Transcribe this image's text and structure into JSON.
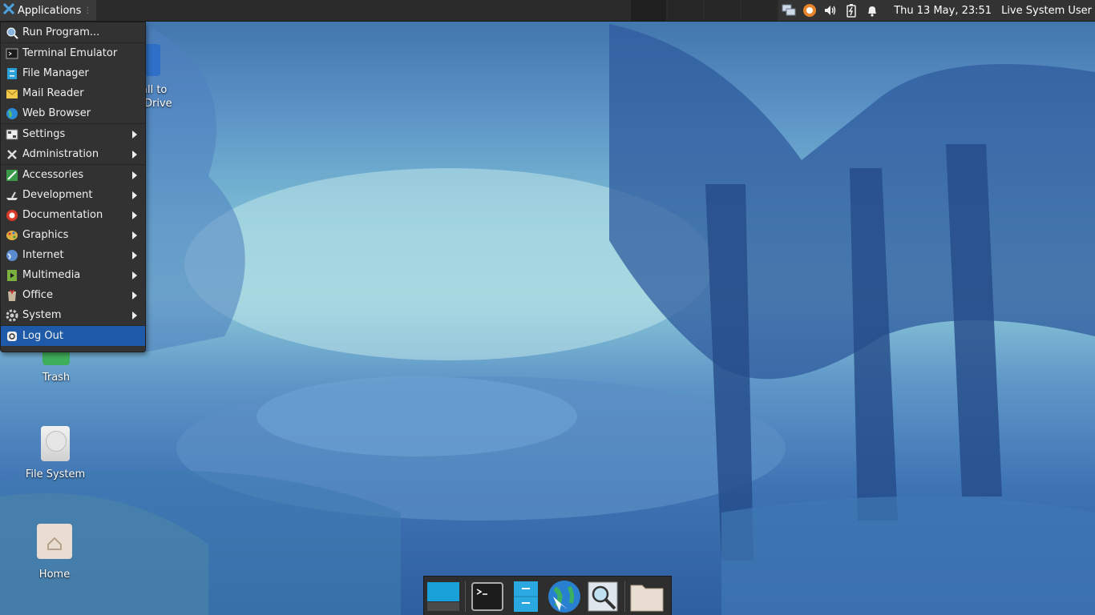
{
  "panel": {
    "applications_label": "Applications",
    "clock": "Thu 13 May, 23:51",
    "user": "Live System User"
  },
  "menu": {
    "items": [
      {
        "label": "Run Program...",
        "icon": "run-program-icon",
        "submenu": false
      },
      {
        "label": "Terminal Emulator",
        "icon": "terminal-icon",
        "submenu": false
      },
      {
        "label": "File Manager",
        "icon": "file-manager-icon",
        "submenu": false
      },
      {
        "label": "Mail Reader",
        "icon": "mail-icon",
        "submenu": false
      },
      {
        "label": "Web Browser",
        "icon": "web-browser-icon",
        "submenu": false
      },
      {
        "label": "Settings",
        "icon": "settings-icon",
        "submenu": true
      },
      {
        "label": "Administration",
        "icon": "administration-icon",
        "submenu": true
      },
      {
        "label": "Accessories",
        "icon": "accessories-icon",
        "submenu": true
      },
      {
        "label": "Development",
        "icon": "development-icon",
        "submenu": true
      },
      {
        "label": "Documentation",
        "icon": "documentation-icon",
        "submenu": true
      },
      {
        "label": "Graphics",
        "icon": "graphics-icon",
        "submenu": true
      },
      {
        "label": "Internet",
        "icon": "internet-icon",
        "submenu": true
      },
      {
        "label": "Multimedia",
        "icon": "multimedia-icon",
        "submenu": true
      },
      {
        "label": "Office",
        "icon": "office-icon",
        "submenu": true
      },
      {
        "label": "System",
        "icon": "system-icon",
        "submenu": true
      },
      {
        "label": "Log Out",
        "icon": "logout-icon",
        "submenu": false
      }
    ]
  },
  "desktop": {
    "install_partial_1": "all to",
    "install_partial_2": "Drive",
    "trash": "Trash",
    "file_system": "File System",
    "home": "Home"
  },
  "colors": {
    "panel": "#2b2b2b",
    "menu_bg": "#323232",
    "menu_highlight": "#1e5aa8"
  }
}
